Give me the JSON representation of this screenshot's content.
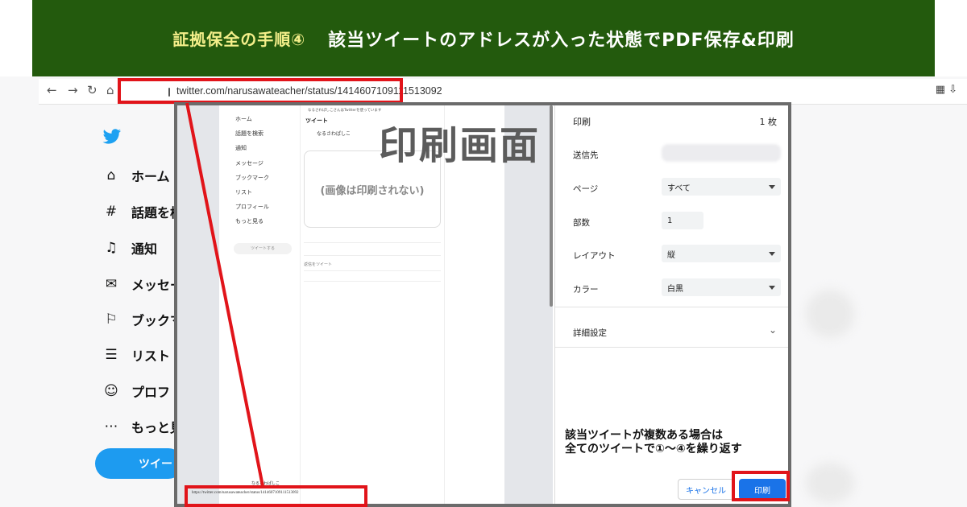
{
  "banner": {
    "step": "証拠保全の手順④",
    "title": "該当ツイートのアドレスが入った状態でPDF保存&印刷"
  },
  "browser": {
    "url": "twitter.com/narusawateacher/status/1414607109111513092"
  },
  "twitter_nav": {
    "items": [
      {
        "label": "ホーム",
        "icon": "home-icon"
      },
      {
        "label": "話題を検",
        "icon": "hashtag-icon"
      },
      {
        "label": "通知",
        "icon": "bell-icon"
      },
      {
        "label": "メッセー",
        "icon": "mail-icon"
      },
      {
        "label": "ブックマ",
        "icon": "bookmark-icon"
      },
      {
        "label": "リスト",
        "icon": "list-icon"
      },
      {
        "label": "プロフ",
        "icon": "profile-icon"
      },
      {
        "label": "もっと見",
        "icon": "more-icon"
      }
    ],
    "tweet_button": "ツイート"
  },
  "preview": {
    "overlay_label": "印刷画面",
    "image_note": "(画像は印刷されない)",
    "mini_header": "ツイート",
    "mini_nav": [
      "ホーム",
      "話題を検索",
      "通知",
      "メッセージ",
      "ブックマーク",
      "リスト",
      "プロフィール",
      "もっと見る"
    ],
    "mini_tweet_btn": "ツイートする",
    "mini_user": "なるさわぱしこ",
    "mini_reply": "返信をツイート",
    "footer_url": "https://twitter.com/narusawateacher/status/1414607109111513092"
  },
  "print_settings": {
    "title": "印刷",
    "count": "1 枚",
    "destination_label": "送信先",
    "pages_label": "ページ",
    "pages_value": "すべて",
    "copies_label": "部数",
    "copies_value": "1",
    "layout_label": "レイアウト",
    "layout_value": "縦",
    "color_label": "カラー",
    "color_value": "白黒",
    "advanced_label": "詳細設定",
    "note_line1": "該当ツイートが複数ある場合は",
    "note_line2": "全てのツイートで①〜④を繰り返す",
    "cancel_label": "キャンセル",
    "print_label": "印刷"
  },
  "colors": {
    "banner_bg": "#235a0d",
    "highlight_red": "#e1141a",
    "primary_blue": "#1a73e8",
    "twitter_blue": "#1d9bf0"
  }
}
